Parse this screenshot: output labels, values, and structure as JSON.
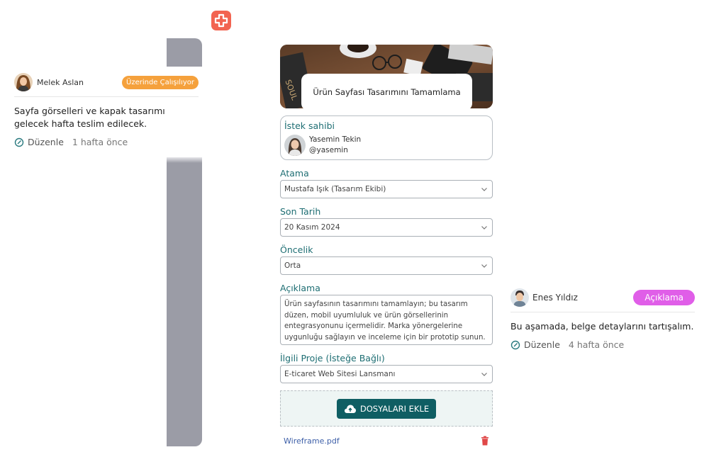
{
  "left_comment": {
    "author": "Melek Aslan",
    "status": "Üzerinde Çalışılıyor",
    "status_color": "#f5a13c",
    "text": "Sayfa görselleri ve kapak tasarımı gelecek hafta teslim edilecek.",
    "edit_label": "Düzenle",
    "time": "1 hafta önce"
  },
  "right_comment": {
    "author": "Enes Yıldız",
    "status": "Açıklama",
    "status_color": "#e05ee8",
    "text": "Bu aşamada, belge detaylarını tartışalım.",
    "edit_label": "Düzenle",
    "time": "4 hafta önce"
  },
  "form": {
    "title": "Ürün Sayfası Tasarımını Tamamlama",
    "requester_label": "İstek sahibi",
    "requester_name": "Yasemin Tekin",
    "requester_handle": "@yasemin",
    "assign_label": "Atama",
    "assign_value": "Mustafa Işık (Tasarım Ekibi)",
    "due_label": "Son Tarih",
    "due_value": "20 Kasım 2024",
    "priority_label": "Öncelik",
    "priority_value": "Orta",
    "description_label": "Açıklama",
    "description_value": "Ürün sayfasının tasarımını tamamlayın; bu tasarım düzen, mobil uyumluluk ve ürün görsellerinin entegrasyonunu içermelidir. Marka yönergelerine uygunluğu sağlayın ve inceleme için bir prototip sunun.",
    "project_label": "İlgili Proje (İsteğe Bağlı)",
    "project_value": "E-ticaret Web Sitesi Lansmanı",
    "upload_label": "DOSYALARI EKLE",
    "attachment": "Wireframe.pdf"
  },
  "colors": {
    "accent": "#0f5e63",
    "label": "#1e6e73",
    "logo": "#f26451",
    "delete": "#e04848"
  },
  "icons": [
    "logo-icon",
    "edit-icon",
    "chevron-down-icon",
    "cloud-upload-icon",
    "trash-icon"
  ]
}
